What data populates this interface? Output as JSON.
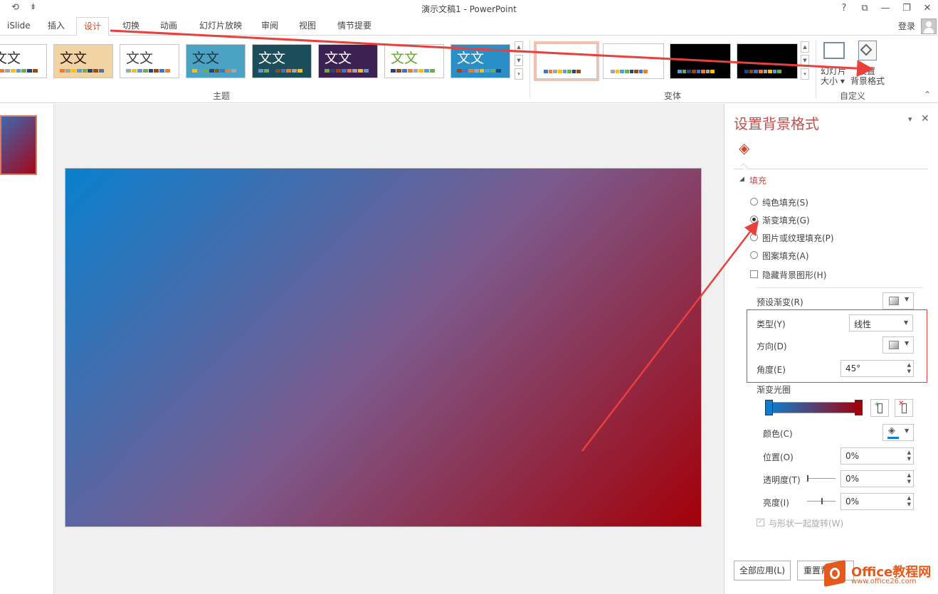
{
  "window": {
    "title": "演示文稿1 - PowerPoint",
    "help": "?",
    "restore": "⧉",
    "minimize": "—",
    "maximize": "❐",
    "close": "✕"
  },
  "qat": {
    "undo_icon": "⟲",
    "more_icon": "⇟"
  },
  "tabs": [
    {
      "label": "iSlide"
    },
    {
      "label": "插入"
    },
    {
      "label": "设计"
    },
    {
      "label": "切换"
    },
    {
      "label": "动画"
    },
    {
      "label": "幻灯片放映"
    },
    {
      "label": "审阅"
    },
    {
      "label": "视图"
    },
    {
      "label": "情节提要"
    }
  ],
  "account": {
    "login": "登录"
  },
  "ribbon": {
    "themes_label": "主题",
    "variants_label": "变体",
    "custom_label": "自定义",
    "themes": [
      {
        "text": "文文",
        "bg": "#ffffff",
        "fg": "#333333"
      },
      {
        "text": "文文",
        "bg": "#f1d3a4",
        "fg": "#2a1a0a"
      },
      {
        "text": "文文",
        "bg": "#ffffff",
        "fg": "#444444"
      },
      {
        "text": "文文",
        "bg": "#4ba3c3",
        "fg": "#1c3345"
      },
      {
        "text": "文文",
        "bg": "#1c4d5a",
        "fg": "#ffffff"
      },
      {
        "text": "文文",
        "bg": "#3c2253",
        "fg": "#ffffff"
      },
      {
        "text": "文文",
        "bg": "#ffffff",
        "fg": "#6aa431"
      },
      {
        "text": "文文",
        "bg": "#2a8fc6",
        "fg": "#ffffff"
      }
    ],
    "variants": [
      {
        "bg": "#ffffff"
      },
      {
        "bg": "#ffffff"
      },
      {
        "bg": "#000000"
      },
      {
        "bg": "#000000"
      }
    ],
    "slide_size": {
      "line1": "幻灯片",
      "line2": "大小 ▾"
    },
    "format_bg": {
      "line1": "设置",
      "line2": "背景格式"
    },
    "collapse_icon": "⌃"
  },
  "pane": {
    "title": "设置背景格式",
    "pin_icon": "▾",
    "close_icon": "✕",
    "fill_icon": "◈",
    "section": "填充",
    "section_toggle": "◢",
    "options": [
      {
        "label": "纯色填充(S)",
        "checked": false
      },
      {
        "label": "渐变填充(G)",
        "checked": true
      },
      {
        "label": "图片或纹理填充(P)",
        "checked": false
      },
      {
        "label": "图案填充(A)",
        "checked": false
      }
    ],
    "hide_bg": {
      "label": "隐藏背景图形(H)"
    },
    "preset": {
      "label": "预设渐变(R)"
    },
    "type": {
      "label": "类型(Y)",
      "value": "线性"
    },
    "direction": {
      "label": "方向(D)"
    },
    "angle": {
      "label": "角度(E)",
      "value": "45°"
    },
    "stops": {
      "label": "渐变光圈",
      "start": "#0f7ccd",
      "end": "#a1000d"
    },
    "color": {
      "label": "颜色(C)"
    },
    "position": {
      "label": "位置(O)",
      "value": "0%"
    },
    "transparency": {
      "label": "透明度(T)",
      "value": "0%"
    },
    "brightness": {
      "label": "亮度(I)",
      "value": "0%"
    },
    "rotate": {
      "label": "与形状一起旋转(W)"
    },
    "apply_all": "全部应用(L)",
    "reset": "重置背",
    "watermark": {
      "line1": "Office教程网",
      "line2": "www.office26.com"
    }
  },
  "colors": {
    "accent": "#d24726",
    "annotation": "#e8403c"
  }
}
